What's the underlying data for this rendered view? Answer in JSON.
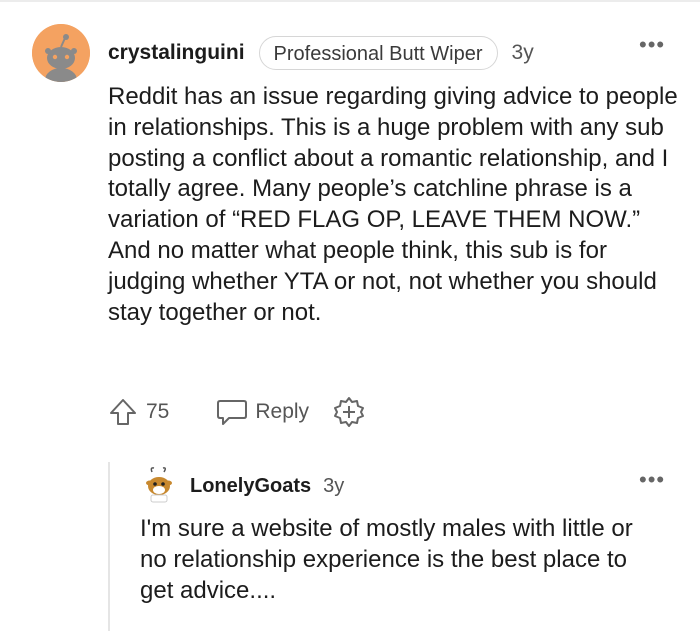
{
  "comment": {
    "username": "crystalinguini",
    "flair": "Professional Butt Wiper",
    "age": "3y",
    "body": "Reddit has an issue regarding giving advice to people in relationships. This is a huge problem with any sub posting a conflict about a romantic relationship, and I totally agree. Many people’s catchline phrase is a variation of “RED FLAG OP, LEAVE THEM NOW.” And no matter what people think, this sub is for judging whether YTA or not, not whether you should stay together or not.",
    "score": "75",
    "reply_label": "Reply"
  },
  "reply": {
    "username": "LonelyGoats",
    "age": "3y",
    "body": "I'm sure a website of mostly males with little or no relationship experience is the best place to get advice...."
  },
  "colors": {
    "avatar_bg": "#f4a261",
    "text": "#1c1c1c",
    "meta": "#555555"
  },
  "icons": [
    "snoo-avatar-icon",
    "more-options-icon",
    "upvote-icon",
    "reply-icon",
    "award-icon",
    "goat-avatar-icon"
  ]
}
